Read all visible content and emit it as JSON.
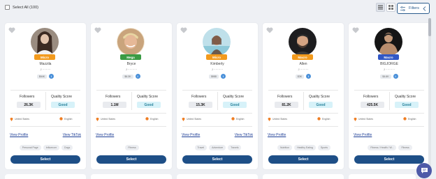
{
  "toolbar": {
    "select_all_label": "Select All (100)",
    "filters_label": "Filters"
  },
  "cards": [
    {
      "tier": "Micro",
      "tier_color": "#f29a1d",
      "name": "Mazzila",
      "handle": "J ·········",
      "rate": "$64K",
      "followers_label": "Followers",
      "followers": "26.3K",
      "quality_label": "Quality Score",
      "quality": "Good",
      "location": "United States",
      "language": "English",
      "view_profile": "View Profile",
      "view_tiktok": "View TikTok",
      "tags": [
        "Personal Page",
        "Influencer",
        "Dogs"
      ],
      "select_label": "Select"
    },
    {
      "tier": "Mega",
      "tier_color": "#3a9b44",
      "name": "Bryce",
      "handle": "J ··········",
      "rate": "$6.3K",
      "followers_label": "Followers",
      "followers": "1.1M",
      "quality_label": "Quality Score",
      "quality": "Good",
      "location": "United States",
      "language": "English",
      "view_profile": "View Profile",
      "view_tiktok": "",
      "tags": [
        "Fitness"
      ],
      "select_label": "Select"
    },
    {
      "tier": "Micro",
      "tier_color": "#f29a1d",
      "name": "Kimberly",
      "handle": "J ··········",
      "rate": "$988",
      "followers_label": "Followers",
      "followers": "15.3K",
      "quality_label": "Quality Score",
      "quality": "Good",
      "location": "United States",
      "language": "English",
      "view_profile": "View Profile",
      "view_tiktok": "View TikTok",
      "tags": [
        "Travel",
        "Adventure",
        "Travels"
      ],
      "select_label": "Select"
    },
    {
      "tier": "Macro",
      "tier_color": "#f29a1d",
      "name": "Allen",
      "handle": "J ·········",
      "rate": "$3K",
      "followers_label": "Followers",
      "followers": "81.2K",
      "quality_label": "Quality Score",
      "quality": "Good",
      "location": "United States",
      "language": "English",
      "view_profile": "View Profile",
      "view_tiktok": "",
      "tags": [
        "Nutrition",
        "Healthy Eating",
        "Sports"
      ],
      "select_label": "Select"
    },
    {
      "tier": "Macro",
      "tier_color": "#3157c5",
      "name": "BIGJORGE",
      "handle": "J ··········",
      "rate": "$4.6K",
      "followers_label": "Followers",
      "followers": "425.5K",
      "quality_label": "Quality Score",
      "quality": "Good",
      "location": "United States",
      "language": "English",
      "view_profile": "View Profile",
      "view_tiktok": "",
      "tags": [
        "Fitness / Health / W...",
        "Fitness"
      ],
      "select_label": "Select"
    }
  ]
}
